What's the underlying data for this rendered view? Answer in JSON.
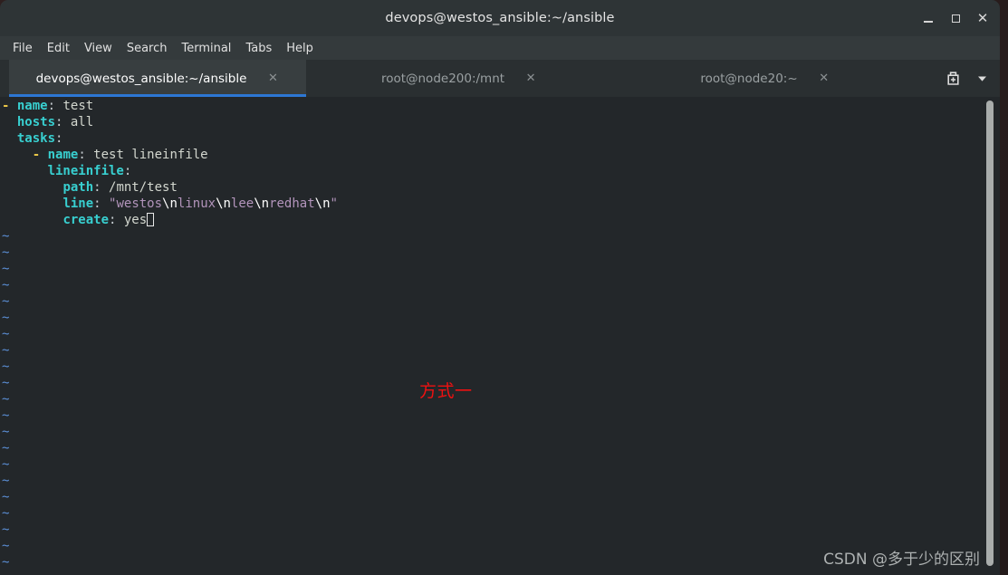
{
  "window": {
    "title": "devops@westos_ansible:~/ansible",
    "controls": {
      "minimize": "minimize-icon",
      "maximize": "maximize-icon",
      "close": "✕"
    }
  },
  "menubar": {
    "items": [
      {
        "label": "File"
      },
      {
        "label": "Edit"
      },
      {
        "label": "View"
      },
      {
        "label": "Search"
      },
      {
        "label": "Terminal"
      },
      {
        "label": "Tabs"
      },
      {
        "label": "Help"
      }
    ]
  },
  "tabbar": {
    "tabs": [
      {
        "label": "devops@westos_ansible:~/ansible",
        "close": "✕",
        "active": true
      },
      {
        "label": "root@node200:/mnt",
        "close": "✕",
        "active": false
      },
      {
        "label": "root@node20:~",
        "close": "✕",
        "active": false
      }
    ],
    "new_tab_icon": "new-tab-icon",
    "dropdown_icon": "▾"
  },
  "terminal": {
    "editor": "vim",
    "content_lines": [
      {
        "tokens": [
          {
            "text": "-",
            "cls": "c-dash"
          },
          {
            "text": " ",
            "cls": "c-val"
          },
          {
            "text": "name",
            "cls": "c-key"
          },
          {
            "text": ":",
            "cls": "c-punct"
          },
          {
            "text": " test",
            "cls": "c-val"
          }
        ]
      },
      {
        "tokens": [
          {
            "text": "  ",
            "cls": "c-val"
          },
          {
            "text": "hosts",
            "cls": "c-key"
          },
          {
            "text": ":",
            "cls": "c-punct"
          },
          {
            "text": " all",
            "cls": "c-val"
          }
        ]
      },
      {
        "tokens": [
          {
            "text": "  ",
            "cls": "c-val"
          },
          {
            "text": "tasks",
            "cls": "c-key"
          },
          {
            "text": ":",
            "cls": "c-punct"
          }
        ]
      },
      {
        "tokens": [
          {
            "text": "    ",
            "cls": "c-val"
          },
          {
            "text": "-",
            "cls": "c-dash"
          },
          {
            "text": " ",
            "cls": "c-val"
          },
          {
            "text": "name",
            "cls": "c-key"
          },
          {
            "text": ":",
            "cls": "c-punct"
          },
          {
            "text": " test lineinfile",
            "cls": "c-val"
          }
        ]
      },
      {
        "tokens": [
          {
            "text": "      ",
            "cls": "c-val"
          },
          {
            "text": "lineinfile",
            "cls": "c-key"
          },
          {
            "text": ":",
            "cls": "c-punct"
          }
        ]
      },
      {
        "tokens": [
          {
            "text": "        ",
            "cls": "c-val"
          },
          {
            "text": "path",
            "cls": "c-key"
          },
          {
            "text": ":",
            "cls": "c-punct"
          },
          {
            "text": " /mnt/test",
            "cls": "c-val"
          }
        ]
      },
      {
        "tokens": [
          {
            "text": "        ",
            "cls": "c-val"
          },
          {
            "text": "line",
            "cls": "c-key"
          },
          {
            "text": ":",
            "cls": "c-punct"
          },
          {
            "text": " ",
            "cls": "c-val"
          },
          {
            "text": "\"westos",
            "cls": "c-str"
          },
          {
            "text": "\\n",
            "cls": "c-esc"
          },
          {
            "text": "linux",
            "cls": "c-str"
          },
          {
            "text": "\\n",
            "cls": "c-esc"
          },
          {
            "text": "lee",
            "cls": "c-str"
          },
          {
            "text": "\\n",
            "cls": "c-esc"
          },
          {
            "text": "redhat",
            "cls": "c-str"
          },
          {
            "text": "\\n",
            "cls": "c-esc"
          },
          {
            "text": "\"",
            "cls": "c-str"
          }
        ]
      },
      {
        "tokens": [
          {
            "text": "        ",
            "cls": "c-val"
          },
          {
            "text": "create",
            "cls": "c-key"
          },
          {
            "text": ":",
            "cls": "c-punct"
          },
          {
            "text": " yes",
            "cls": "c-val"
          },
          {
            "text": "",
            "cls": "cursor-token"
          }
        ]
      }
    ],
    "empty_marker": "~",
    "empty_line_count": 21,
    "annotation": "方式一",
    "watermark": "CSDN @多于少的区别",
    "colors": {
      "background": "#23272a",
      "key": "#38cfd0",
      "value": "#d3d7cf",
      "string": "#b294bb",
      "escape": "#ffffff",
      "dash": "#e8c547",
      "tilde": "#5b8fd6",
      "annotation": "#ef1111",
      "accent": "#2d77d4"
    }
  }
}
